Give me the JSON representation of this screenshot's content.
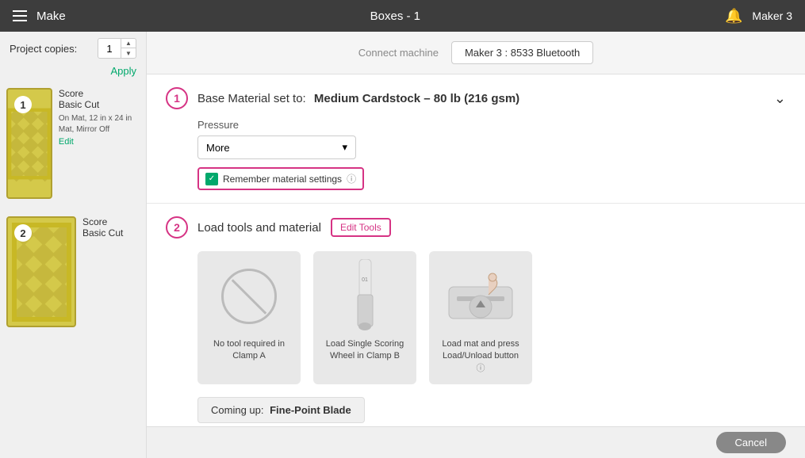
{
  "topbar": {
    "title": "Boxes - 1",
    "machine": "Maker 3",
    "app_name": "Make"
  },
  "connect_bar": {
    "label": "Connect machine",
    "machine_name": "Maker 3 : 8533 Bluetooth"
  },
  "sidebar": {
    "project_copies_label": "Project copies:",
    "copies_value": "1",
    "apply_label": "Apply",
    "items": [
      {
        "number": "1",
        "score_label": "Score",
        "cut_label": "Basic Cut",
        "mat_info": "On Mat, 12 in x 24 in Mat, Mirror Off",
        "edit_label": "Edit"
      },
      {
        "number": "2",
        "score_label": "Score",
        "cut_label": "Basic Cut",
        "mat_info": "",
        "edit_label": ""
      }
    ]
  },
  "step1": {
    "number": "1",
    "prefix": "Base Material set to:",
    "material": "Medium Cardstock – 80 lb (216 gsm)",
    "pressure_label": "Pressure",
    "pressure_value": "More",
    "remember_label": "Remember material settings",
    "expand_icon": "⌄"
  },
  "step2": {
    "number": "2",
    "title": "Load tools and material",
    "edit_tools_label": "Edit Tools",
    "tools": [
      {
        "label": "No tool required in Clamp A"
      },
      {
        "label": "Load Single Scoring Wheel in Clamp B"
      },
      {
        "label": "Load mat and press Load/Unload button"
      }
    ],
    "coming_up_prefix": "Coming up:",
    "coming_up_value": "Fine-Point Blade"
  },
  "bottom": {
    "cancel_label": "Cancel"
  }
}
